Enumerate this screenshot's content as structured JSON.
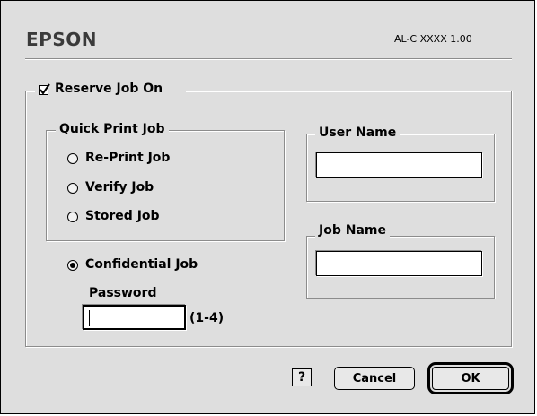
{
  "header": {
    "brand": "EPSON",
    "version": "AL-C XXXX 1.00"
  },
  "reserve": {
    "label": "Reserve Job On",
    "checked": true
  },
  "quick_print": {
    "legend": "Quick Print Job",
    "options": [
      {
        "label": "Re-Print Job",
        "selected": false
      },
      {
        "label": "Verify  Job",
        "selected": false
      },
      {
        "label": "Stored Job",
        "selected": false
      }
    ]
  },
  "confidential": {
    "label": "Confidential Job",
    "selected": true,
    "password_label": "Password",
    "password_value": "",
    "password_hint": "(1-4)"
  },
  "user_name": {
    "legend": "User Name",
    "value": ""
  },
  "job_name": {
    "legend": "Job Name",
    "value": ""
  },
  "buttons": {
    "help": "?",
    "cancel": "Cancel",
    "ok": "OK"
  }
}
